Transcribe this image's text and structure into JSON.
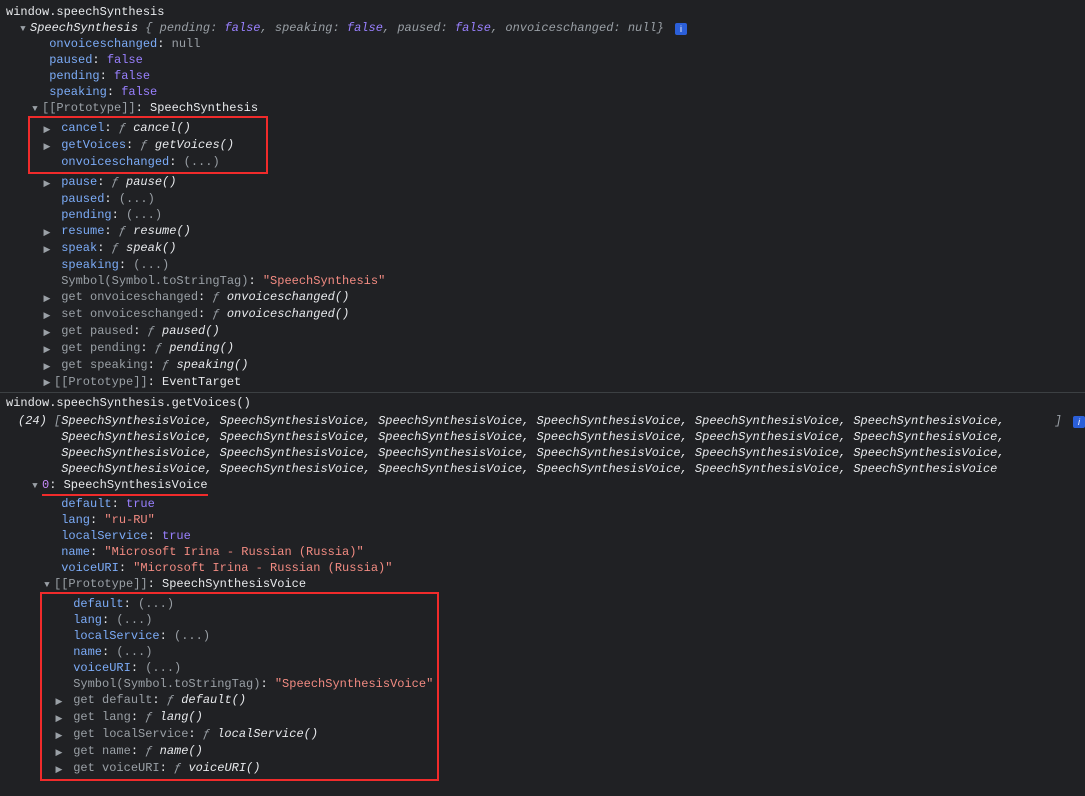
{
  "cmd1": "window.speechSynthesis",
  "header": {
    "type": "SpeechSynthesis",
    "brace_open": "{",
    "fields": [
      {
        "k": "pending",
        "v": "false",
        "vtype": "bool"
      },
      {
        "k": "speaking",
        "v": "false",
        "vtype": "bool"
      },
      {
        "k": "paused",
        "v": "false",
        "vtype": "bool"
      },
      {
        "k": "onvoiceschanged",
        "v": "null",
        "vtype": "null"
      }
    ],
    "brace_close": "}"
  },
  "own_props": [
    {
      "k": "onvoiceschanged",
      "v": "null",
      "vtype": "null"
    },
    {
      "k": "paused",
      "v": "false",
      "vtype": "bool"
    },
    {
      "k": "pending",
      "v": "false",
      "vtype": "bool"
    },
    {
      "k": "speaking",
      "v": "false",
      "vtype": "bool"
    }
  ],
  "proto_label": "[[Prototype]]",
  "proto_type": "SpeechSynthesis",
  "highlight_box1": {
    "line1": {
      "k": "cancel",
      "fn": "cancel()"
    },
    "line2": {
      "k": "getVoices",
      "fn": "getVoices()"
    },
    "line3": {
      "k": "onvoiceschanged",
      "v": "(...)"
    }
  },
  "proto_methods": [
    {
      "arrow": true,
      "k": "pause",
      "fn": "pause()"
    },
    {
      "arrow": false,
      "k": "paused",
      "v": "(...)"
    },
    {
      "arrow": false,
      "k": "pending",
      "v": "(...)"
    },
    {
      "arrow": true,
      "k": "resume",
      "fn": "resume()"
    },
    {
      "arrow": true,
      "k": "speak",
      "fn": "speak()"
    },
    {
      "arrow": false,
      "k": "speaking",
      "v": "(...)"
    }
  ],
  "symbol_line": {
    "k": "Symbol(Symbol.toStringTag)",
    "v": "\"SpeechSynthesis\""
  },
  "getters": [
    {
      "k": "get onvoiceschanged",
      "fn": "onvoiceschanged()"
    },
    {
      "k": "set onvoiceschanged",
      "fn": "onvoiceschanged()"
    },
    {
      "k": "get paused",
      "fn": "paused()"
    },
    {
      "k": "get pending",
      "fn": "pending()"
    },
    {
      "k": "get speaking",
      "fn": "speaking()"
    }
  ],
  "proto2_label": "[[Prototype]]",
  "proto2_type": "EventTarget",
  "cmd2": "window.speechSynthesis.getVoices()",
  "array_summary": {
    "count": "(24)",
    "item": "SpeechSynthesisVoice",
    "open": "[",
    "close": "]",
    "sep": ", "
  },
  "voice_index_label": "0",
  "voice_type": "SpeechSynthesisVoice",
  "voice_props": [
    {
      "k": "default",
      "v": "true",
      "vtype": "bool"
    },
    {
      "k": "lang",
      "v": "\"ru-RU\"",
      "vtype": "str"
    },
    {
      "k": "localService",
      "v": "true",
      "vtype": "bool"
    },
    {
      "k": "name",
      "v": "\"Microsoft Irina - Russian (Russia)\"",
      "vtype": "str"
    },
    {
      "k": "voiceURI",
      "v": "\"Microsoft Irina - Russian (Russia)\"",
      "vtype": "str"
    }
  ],
  "voice_proto_label": "[[Prototype]]",
  "voice_proto_type": "SpeechSynthesisVoice",
  "highlight_box2": {
    "ellipsis": [
      {
        "k": "default"
      },
      {
        "k": "lang"
      },
      {
        "k": "localService"
      },
      {
        "k": "name"
      },
      {
        "k": "voiceURI"
      }
    ],
    "symbol": {
      "k": "Symbol(Symbol.toStringTag)",
      "v": "\"SpeechSynthesisVoice\""
    },
    "getters": [
      {
        "k": "get default",
        "fn": "default()"
      },
      {
        "k": "get lang",
        "fn": "lang()"
      },
      {
        "k": "get localService",
        "fn": "localService()"
      },
      {
        "k": "get name",
        "fn": "name()"
      },
      {
        "k": "get voiceURI",
        "fn": "voiceURI()"
      }
    ]
  },
  "ellipsis_val": "(...)",
  "f_glyph": "ƒ",
  "info_glyph": "i"
}
